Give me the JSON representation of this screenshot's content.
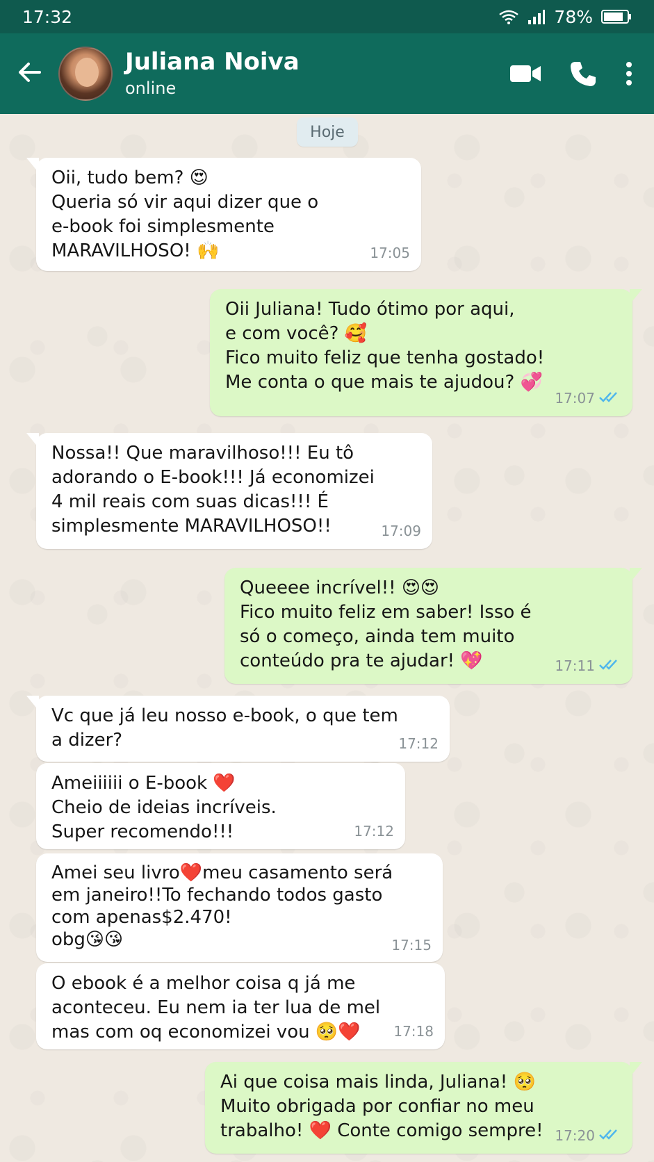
{
  "status_bar": {
    "time": "17:32",
    "battery": "78%"
  },
  "header": {
    "name": "Juliana Noiva",
    "status": "online"
  },
  "day_chip": "Hoje",
  "messages": [
    {
      "direction": "in",
      "text": "Oii, tudo bem? 😍\nQueria só vir aqui dizer que o\ne-book foi simplesmente\nMARAVILHOSO! 🙌",
      "time": "17:05"
    },
    {
      "direction": "out",
      "text": "Oii Juliana! Tudo ótimo por aqui,\ne com você? 🥰\nFico muito feliz que tenha gostado!\nMe conta o que mais te ajudou? 💞",
      "time": "17:07",
      "read": true
    },
    {
      "direction": "in",
      "text": "Nossa!! Que maravilhoso!!! Eu tô\nadorando o E-book!!! Já economizei\n4 mil reais com suas dicas!!! É\nsimplesmente MARAVILHOSO!!",
      "time": "17:09"
    },
    {
      "direction": "out",
      "text": "Queeee incrível!! 😍😍\nFico muito feliz em saber! Isso é\nsó o começo, ainda tem muito\nconteúdo pra te ajudar! 💖",
      "time": "17:11",
      "read": true
    },
    {
      "direction": "in",
      "text": "Vc que já leu nosso e-book, o que tem\na dizer?",
      "time": "17:12"
    },
    {
      "direction": "in",
      "text": "Ameiiiiii o E-book ❤️\nCheio de ideias incríveis.\nSuper recomendo!!!",
      "time": "17:12"
    },
    {
      "direction": "in",
      "text": "Amei seu livro❤️meu casamento será\nem janeiro!!To fechando todos gasto\ncom apenas$2.470!\nobg😘😘",
      "time": "17:15"
    },
    {
      "direction": "in",
      "text": "O ebook é a melhor coisa q já me\naconteceu. Eu nem ia ter lua de mel\nmas com oq economizei vou 🥺❤️",
      "time": "17:18"
    },
    {
      "direction": "out",
      "text": "Ai que coisa mais linda, Juliana! 🥺\nMuito obrigada por confiar no meu\ntrabalho! ❤️ Conte comigo sempre!",
      "time": "17:20",
      "read": true
    }
  ],
  "colors": {
    "header": "#0f6b5c",
    "status_bar": "#0f5a4e",
    "outgoing_bubble": "#dcf8c6",
    "incoming_bubble": "#ffffff",
    "read_ticks": "#4fb6ec"
  },
  "icons": [
    "back-arrow-icon",
    "video-call-icon",
    "phone-icon",
    "more-vertical-icon",
    "wifi-icon",
    "signal-icon",
    "battery-icon",
    "double-check-icon"
  ]
}
